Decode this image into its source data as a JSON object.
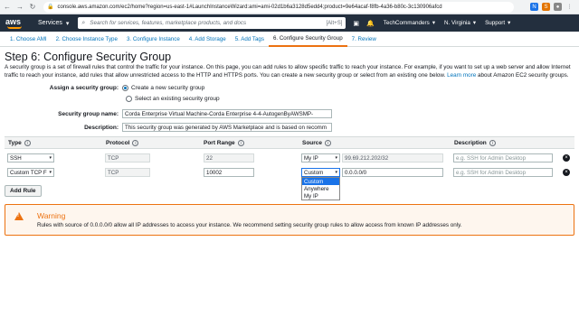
{
  "browser": {
    "url": "console.aws.amazon.com/ec2/home?region=us-east-1#LaunchInstanceWizard:ami=ami-02d1b6a3128d5edd4;product=9e64acaf-f8fb-4a36-b80c-3c130906afcd"
  },
  "header": {
    "logo_text": "aws",
    "services_label": "Services",
    "search_placeholder": "Search for services, features, marketplace products, and docs",
    "search_shortcut": "[Alt+S]",
    "account": "TechCommanders",
    "region": "N. Virginia",
    "support": "Support"
  },
  "wizard": {
    "tabs": [
      {
        "label": "1. Choose AMI"
      },
      {
        "label": "2. Choose Instance Type"
      },
      {
        "label": "3. Configure Instance"
      },
      {
        "label": "4. Add Storage"
      },
      {
        "label": "5. Add Tags"
      },
      {
        "label": "6. Configure Security Group"
      },
      {
        "label": "7. Review"
      }
    ],
    "active_index": 5
  },
  "page": {
    "title": "Step 6: Configure Security Group",
    "intro": "A security group is a set of firewall rules that control the traffic for your instance. On this page, you can add rules to allow specific traffic to reach your instance. For example, if you want to set up a web server and allow Internet traffic to reach your instance, add rules that allow unrestricted access to the HTTP and HTTPS ports. You can create a new security group or select from an existing one below.",
    "learn_more": "Learn more",
    "intro_tail": "about Amazon EC2 security groups."
  },
  "form": {
    "assign_label": "Assign a security group:",
    "option_new": "Create a new security group",
    "option_existing": "Select an existing security group",
    "selected_option": "new",
    "name_label": "Security group name:",
    "name_value": "Corda Enterprise Virtual Machine-Corda Enterprise 4-4-AutogenByAWSMP-",
    "description_label": "Description:",
    "description_value": "This security group was generated by AWS Marketplace and is based on recomm"
  },
  "table": {
    "headers": {
      "type": "Type",
      "protocol": "Protocol",
      "port_range": "Port Range",
      "source": "Source",
      "description": "Description"
    },
    "rows": [
      {
        "type": "SSH",
        "protocol": "TCP",
        "port": "22",
        "source_mode": "My IP",
        "source_value": "99.69.212.202/32",
        "description_placeholder": "e.g. SSH for Admin Desktop"
      },
      {
        "type": "Custom TCP F",
        "protocol": "TCP",
        "port": "10002",
        "source_mode": "Custom",
        "source_value": "0.0.0.0/0",
        "description_placeholder": "e.g. SSH for Admin Desktop"
      }
    ],
    "source_options": [
      "Custom",
      "Anywhere",
      "My IP"
    ],
    "source_selected": "Custom"
  },
  "add_rule_label": "Add Rule",
  "warning": {
    "title": "Warning",
    "text": "Rules with source of 0.0.0.0/0 allow all IP addresses to access your instance. We recommend setting security group rules to allow access from known IP addresses only."
  }
}
